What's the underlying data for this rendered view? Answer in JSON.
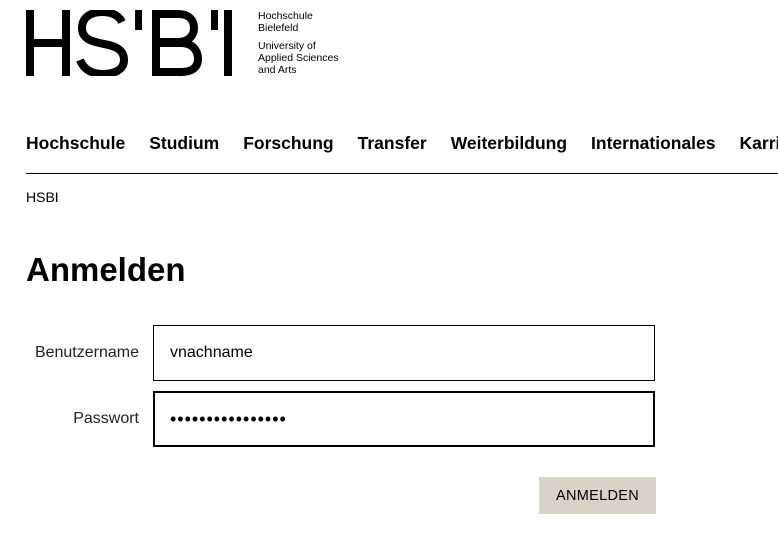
{
  "logo": {
    "wordmark": "HSBI",
    "line1": "Hochschule",
    "line2": "Bielefeld",
    "line3": "University of",
    "line4": "Applied Sciences",
    "line5": "and Arts"
  },
  "nav": {
    "items": [
      {
        "label": "Hochschule"
      },
      {
        "label": "Studium"
      },
      {
        "label": "Forschung"
      },
      {
        "label": "Transfer"
      },
      {
        "label": "Weiterbildung"
      },
      {
        "label": "Internationales"
      },
      {
        "label": "Karriere"
      }
    ]
  },
  "breadcrumb": {
    "item1": "HSBI"
  },
  "page": {
    "title": "Anmelden"
  },
  "form": {
    "username": {
      "label": "Benutzername",
      "value": "vnachname"
    },
    "password": {
      "label": "Passwort",
      "value": "••••••••••••••••"
    },
    "submit_label": "ANMELDEN"
  },
  "colors": {
    "text": "#000000",
    "background": "#ffffff",
    "button_bg": "#d8d2c7"
  }
}
